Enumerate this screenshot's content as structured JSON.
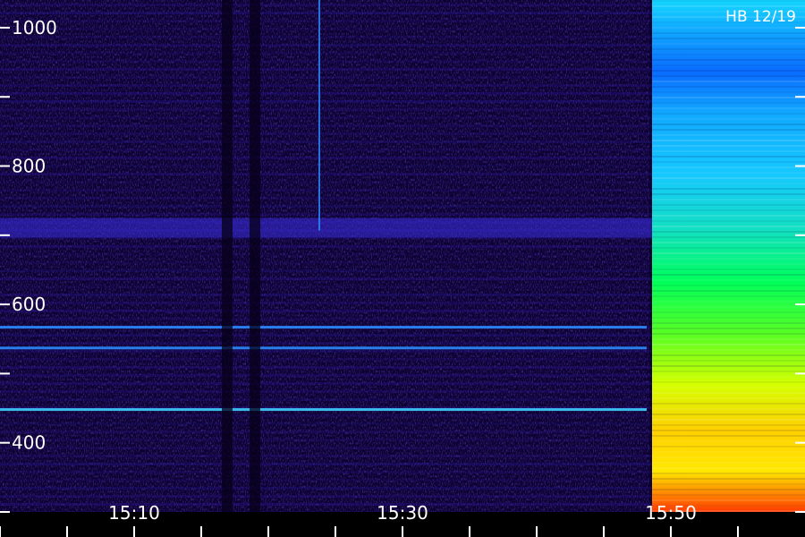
{
  "chart_data": {
    "type": "heatmap",
    "title": "",
    "xlabel": "",
    "ylabel": "",
    "annotation": "HB 12/19",
    "x_tick_labels": [
      "15:10",
      "15:30",
      "15:50"
    ],
    "y_ticks": [
      400,
      600,
      800,
      1000
    ],
    "y_tick_labels": [
      "400",
      "600",
      "800",
      "1000"
    ],
    "ylim": [
      300,
      1040
    ],
    "grid": false,
    "colormap": [
      "#0b0030",
      "#1f0a78",
      "#3b1fd0",
      "#1e78ff",
      "#00e0ff",
      "#00ff80",
      "#c8ff00",
      "#ffe000",
      "#ff8000",
      "#ff0000"
    ],
    "spectral_lines_y": [
      448,
      537,
      567,
      712
    ],
    "gaps_x_fraction": [
      0.282,
      0.317
    ],
    "bright_block_start_fraction": 0.81
  }
}
